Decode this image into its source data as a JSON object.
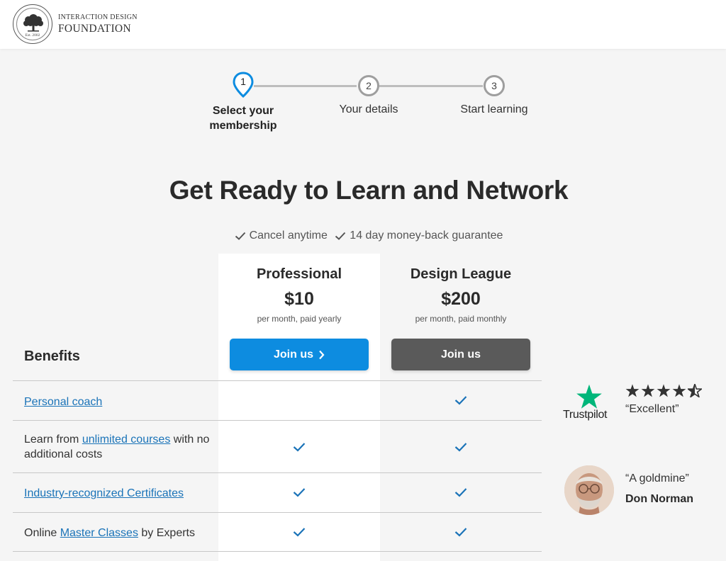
{
  "header": {
    "logo_line1": "INTERACTION DESIGN",
    "logo_line2": "FOUNDATION",
    "logo_est": "Est. 2002"
  },
  "stepper": {
    "steps": [
      {
        "number": "1",
        "label": "Select your membership",
        "state": "active"
      },
      {
        "number": "2",
        "label": "Your details",
        "state": "pending"
      },
      {
        "number": "3",
        "label": "Start learning",
        "state": "pending"
      }
    ]
  },
  "headline": "Get Ready to Learn and Network",
  "guarantees": [
    "Cancel anytime",
    "14 day money-back guarantee"
  ],
  "plans": [
    {
      "name": "Professional",
      "price": "$10",
      "note": "per month, paid yearly",
      "button": "Join us",
      "button_color": "#0d8ce0",
      "highlighted": true
    },
    {
      "name": "Design League",
      "price": "$200",
      "note": "per month, paid monthly",
      "button": "Join us",
      "button_color": "#5a5a5a",
      "highlighted": false
    }
  ],
  "benefits_title": "Benefits",
  "benefits": [
    {
      "segments": [
        {
          "text": "Personal coach",
          "link": true
        }
      ],
      "professional": false,
      "design_league": true
    },
    {
      "segments": [
        {
          "text": "Learn from ",
          "link": false
        },
        {
          "text": "unlimited courses",
          "link": true
        },
        {
          "text": " with no additional costs",
          "link": false
        }
      ],
      "professional": true,
      "design_league": true
    },
    {
      "segments": [
        {
          "text": "Industry-recognized Certificates",
          "link": true
        }
      ],
      "professional": true,
      "design_league": true
    },
    {
      "segments": [
        {
          "text": "Online ",
          "link": false
        },
        {
          "text": "Master Classes",
          "link": true
        },
        {
          "text": " by Experts",
          "link": false
        }
      ],
      "professional": true,
      "design_league": true
    }
  ],
  "testimonials": {
    "trustpilot_label": "Trustpilot",
    "trustpilot_rating": 4.5,
    "trustpilot_quote": "“Excellent”",
    "person_quote": "“A goldmine”",
    "person_name": "Don Norman"
  },
  "colors": {
    "accent": "#0d8ce0",
    "link": "#1a73b8",
    "check": "#1a73b8",
    "trustpilot_green": "#00b67a"
  }
}
